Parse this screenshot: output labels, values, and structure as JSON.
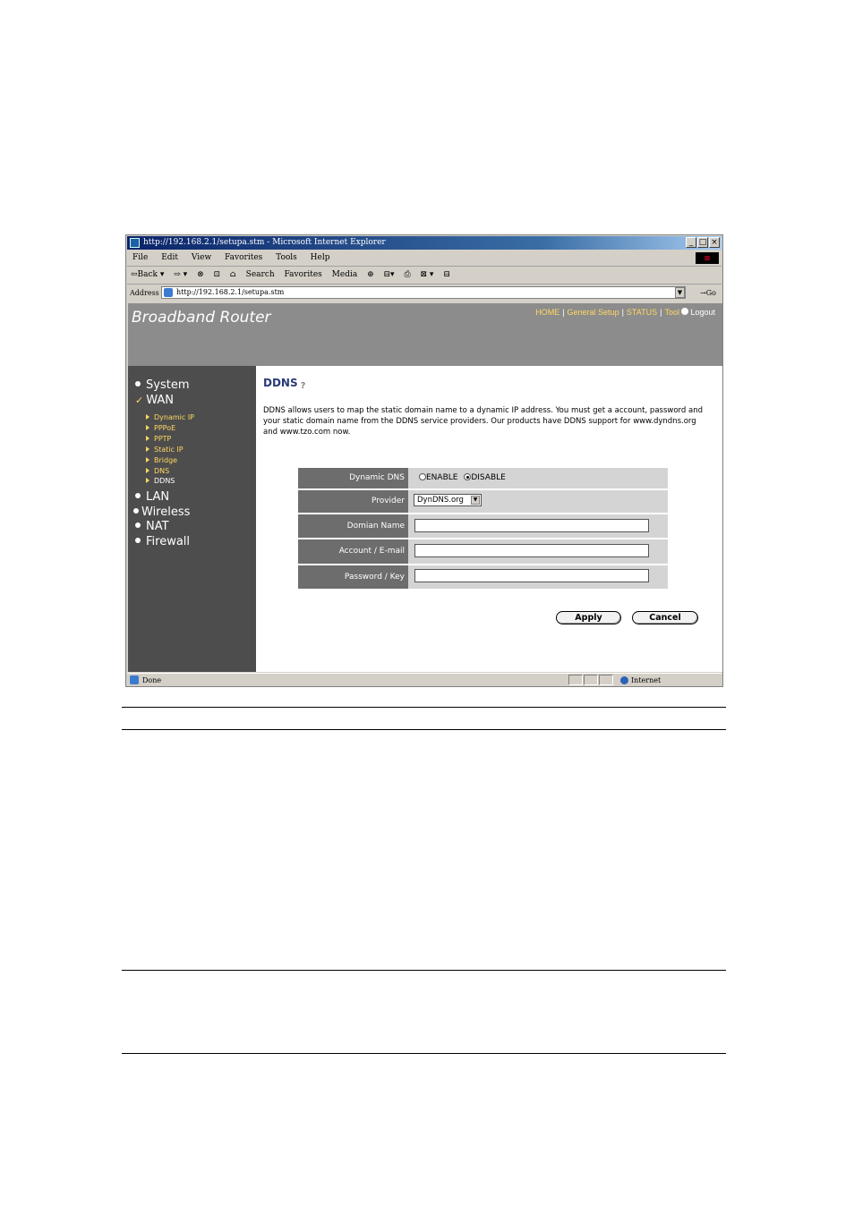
{
  "browser": {
    "title": "http://192.168.2.1/setupa.stm - Microsoft Internet Explorer",
    "title_buttons": [
      "_",
      "□",
      "×"
    ],
    "menu": [
      "File",
      "Edit",
      "View",
      "Favorites",
      "Tools",
      "Help"
    ],
    "toolbar": [
      "⇦Back ▾",
      "⇨ ▾",
      "⊗",
      "⊡",
      "⌂",
      "Search",
      "Favorites",
      "Media",
      "⊕",
      "⊟▾",
      "⎙",
      "⊠ ▾",
      "⊟"
    ],
    "address_label": "Address",
    "address_value": "http://192.168.2.1/setupa.stm",
    "go_label": "Go",
    "status_text": "Done",
    "zone_text": "Internet"
  },
  "router": {
    "brand": "Broadband Router",
    "nav": [
      "HOME",
      "General Setup",
      "STATUS",
      "Tool",
      "Logout"
    ],
    "sidebar": {
      "items": [
        {
          "label": "System"
        },
        {
          "label": "WAN"
        },
        {
          "label": "LAN"
        },
        {
          "label": "Wireless"
        },
        {
          "label": "NAT"
        },
        {
          "label": "Firewall"
        }
      ],
      "wan_sub": [
        "Dynamic IP",
        "PPPoE",
        "PPTP",
        "Static IP",
        "Bridge",
        "DNS",
        "DDNS"
      ]
    },
    "page_title": "DDNS",
    "description": "DDNS allows users to map the static domain name to a dynamic IP address. You must get a account, password and your static domain name from the DDNS service providers. Our products have DDNS support for www.dyndns.org and www.tzo.com now.",
    "form": {
      "dynamic_dns_label": "Dynamic DNS",
      "enable_label": "ENABLE",
      "disable_label": "DISABLE",
      "selected": "DISABLE",
      "provider_label": "Provider",
      "provider_value": "DynDNS.org",
      "domain_label": "Domian Name",
      "domain_value": "",
      "account_label": "Account / E-mail",
      "account_value": "",
      "password_label": "Password / Key",
      "password_value": ""
    },
    "apply_label": "Apply",
    "cancel_label": "Cancel"
  }
}
